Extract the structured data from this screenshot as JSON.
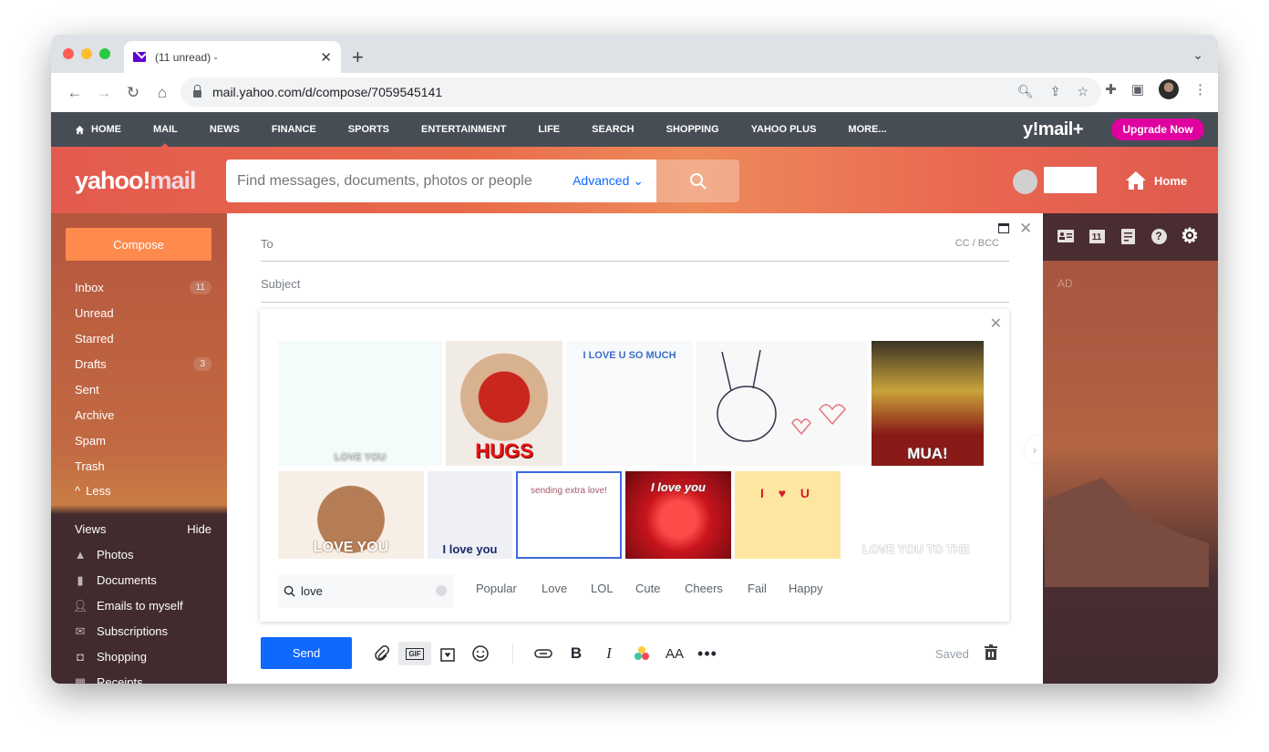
{
  "browser": {
    "tab_title": "(11 unread) -",
    "url": "mail.yahoo.com/d/compose/7059545141"
  },
  "yahoo_nav": {
    "items": [
      "HOME",
      "MAIL",
      "NEWS",
      "FINANCE",
      "SPORTS",
      "ENTERTAINMENT",
      "LIFE",
      "SEARCH",
      "SHOPPING",
      "YAHOO PLUS",
      "MORE..."
    ],
    "active": "MAIL",
    "brand": "y!mail+",
    "upgrade_label": "Upgrade Now"
  },
  "header": {
    "logo_left": "yahoo!",
    "logo_right": "mail",
    "search_placeholder": "Find messages, documents, photos or people",
    "advanced_label": "Advanced",
    "home_label": "Home"
  },
  "sidebar": {
    "compose_label": "Compose",
    "folders": [
      {
        "label": "Inbox",
        "count": "11"
      },
      {
        "label": "Unread",
        "count": ""
      },
      {
        "label": "Starred",
        "count": ""
      },
      {
        "label": "Drafts",
        "count": "3"
      },
      {
        "label": "Sent",
        "count": ""
      },
      {
        "label": "Archive",
        "count": ""
      },
      {
        "label": "Spam",
        "count": ""
      },
      {
        "label": "Trash",
        "count": ""
      }
    ],
    "less_label": "Less",
    "views_label": "Views",
    "hide_label": "Hide",
    "views": [
      {
        "label": "Photos",
        "icon": "photos-icon"
      },
      {
        "label": "Documents",
        "icon": "document-icon"
      },
      {
        "label": "Emails to myself",
        "icon": "emails-to-myself-icon"
      },
      {
        "label": "Subscriptions",
        "icon": "subscriptions-icon"
      },
      {
        "label": "Shopping",
        "icon": "shopping-bag-icon"
      },
      {
        "label": "Receipts",
        "icon": "receipts-icon"
      }
    ]
  },
  "compose": {
    "to_label": "To",
    "cc_bcc_label": "CC / BCC",
    "subject_label": "Subject",
    "send_label": "Send",
    "saved_label": "Saved"
  },
  "gif_picker": {
    "search_value": "love",
    "categories": [
      "Popular",
      "Love",
      "LOL",
      "Cute",
      "Cheers",
      "Fail",
      "Happy"
    ],
    "gifs": [
      {
        "caption": "LOVE YOU",
        "bg": "#f3fbfb"
      },
      {
        "caption": "HUGS",
        "bg": "#f1ebe6"
      },
      {
        "caption": "I LOVE U SO MUCH",
        "bg": "#f7f9fb"
      },
      {
        "caption": "",
        "bg": "#f8f8f8"
      },
      {
        "caption": "MUA!",
        "bg": "#8a1a18"
      },
      {
        "caption": "LOVE YOU",
        "bg": "#f7efe6"
      },
      {
        "caption": "I love you",
        "bg": "#eef0f6"
      },
      {
        "caption": "sending extra love!",
        "bg": "#ffffff"
      },
      {
        "caption": "I love you",
        "bg": "#c8141c"
      },
      {
        "caption": "I ♥ U",
        "bg": "#fde7a0"
      },
      {
        "caption": "LOVE YOU TO THE",
        "bg": "#ffffff"
      }
    ]
  },
  "right_panel": {
    "ad_label": "AD",
    "calendar_day": "11"
  }
}
